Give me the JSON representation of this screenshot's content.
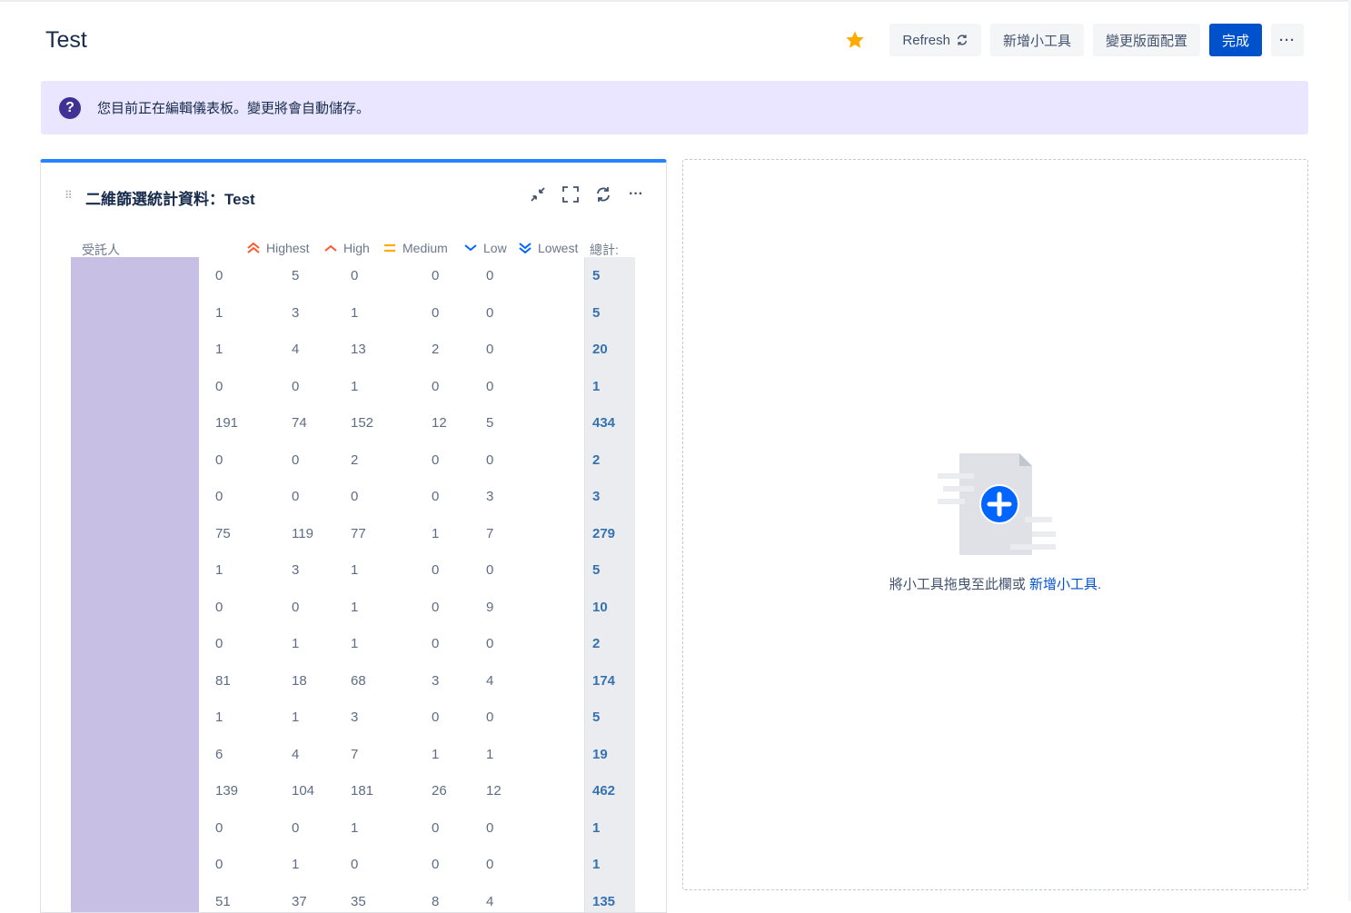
{
  "page": {
    "title": "Test"
  },
  "toolbar": {
    "refresh_label": "Refresh",
    "add_gadget_label": "新增小工具",
    "change_layout_label": "變更版面配置",
    "done_label": "完成",
    "more_label": "···"
  },
  "banner": {
    "text": "您目前正在編輯儀表板。變更將會自動儲存。"
  },
  "gadget": {
    "title": "二維篩選統計資料：Test",
    "columns": {
      "assignee": "受託人",
      "highest": "Highest",
      "high": "High",
      "medium": "Medium",
      "low": "Low",
      "lowest": "Lowest",
      "total": "總計:"
    },
    "rows": [
      {
        "highest": "0",
        "high": "5",
        "medium": "0",
        "low": "0",
        "lowest": "0",
        "total": "5"
      },
      {
        "highest": "1",
        "high": "3",
        "medium": "1",
        "low": "0",
        "lowest": "0",
        "total": "5"
      },
      {
        "highest": "1",
        "high": "4",
        "medium": "13",
        "low": "2",
        "lowest": "0",
        "total": "20"
      },
      {
        "highest": "0",
        "high": "0",
        "medium": "1",
        "low": "0",
        "lowest": "0",
        "total": "1"
      },
      {
        "highest": "191",
        "high": "74",
        "medium": "152",
        "low": "12",
        "lowest": "5",
        "total": "434"
      },
      {
        "highest": "0",
        "high": "0",
        "medium": "2",
        "low": "0",
        "lowest": "0",
        "total": "2"
      },
      {
        "highest": "0",
        "high": "0",
        "medium": "0",
        "low": "0",
        "lowest": "3",
        "total": "3"
      },
      {
        "highest": "75",
        "high": "119",
        "medium": "77",
        "low": "1",
        "lowest": "7",
        "total": "279"
      },
      {
        "highest": "1",
        "high": "3",
        "medium": "1",
        "low": "0",
        "lowest": "0",
        "total": "5"
      },
      {
        "highest": "0",
        "high": "0",
        "medium": "1",
        "low": "0",
        "lowest": "9",
        "total": "10"
      },
      {
        "highest": "0",
        "high": "1",
        "medium": "1",
        "low": "0",
        "lowest": "0",
        "total": "2"
      },
      {
        "highest": "81",
        "high": "18",
        "medium": "68",
        "low": "3",
        "lowest": "4",
        "total": "174"
      },
      {
        "highest": "1",
        "high": "1",
        "medium": "3",
        "low": "0",
        "lowest": "0",
        "total": "5"
      },
      {
        "highest": "6",
        "high": "4",
        "medium": "7",
        "low": "1",
        "lowest": "1",
        "total": "19"
      },
      {
        "highest": "139",
        "high": "104",
        "medium": "181",
        "low": "26",
        "lowest": "12",
        "total": "462"
      },
      {
        "highest": "0",
        "high": "0",
        "medium": "1",
        "low": "0",
        "lowest": "0",
        "total": "1"
      },
      {
        "highest": "0",
        "high": "1",
        "medium": "0",
        "low": "0",
        "lowest": "0",
        "total": "1"
      },
      {
        "highest": "51",
        "high": "37",
        "medium": "35",
        "low": "8",
        "lowest": "4",
        "total": "135"
      }
    ]
  },
  "dropzone": {
    "text": "將小工具拖曳至此欄或",
    "link": "新增小工具",
    "suffix": "."
  },
  "colors": {
    "accent": "#0052cc",
    "star": "#ffab00",
    "banner_bg": "#eae6ff",
    "gadget_top": "#2684ff",
    "priority_highest": "#ff5630",
    "priority_medium": "#ffab00",
    "priority_low": "#0065ff"
  }
}
